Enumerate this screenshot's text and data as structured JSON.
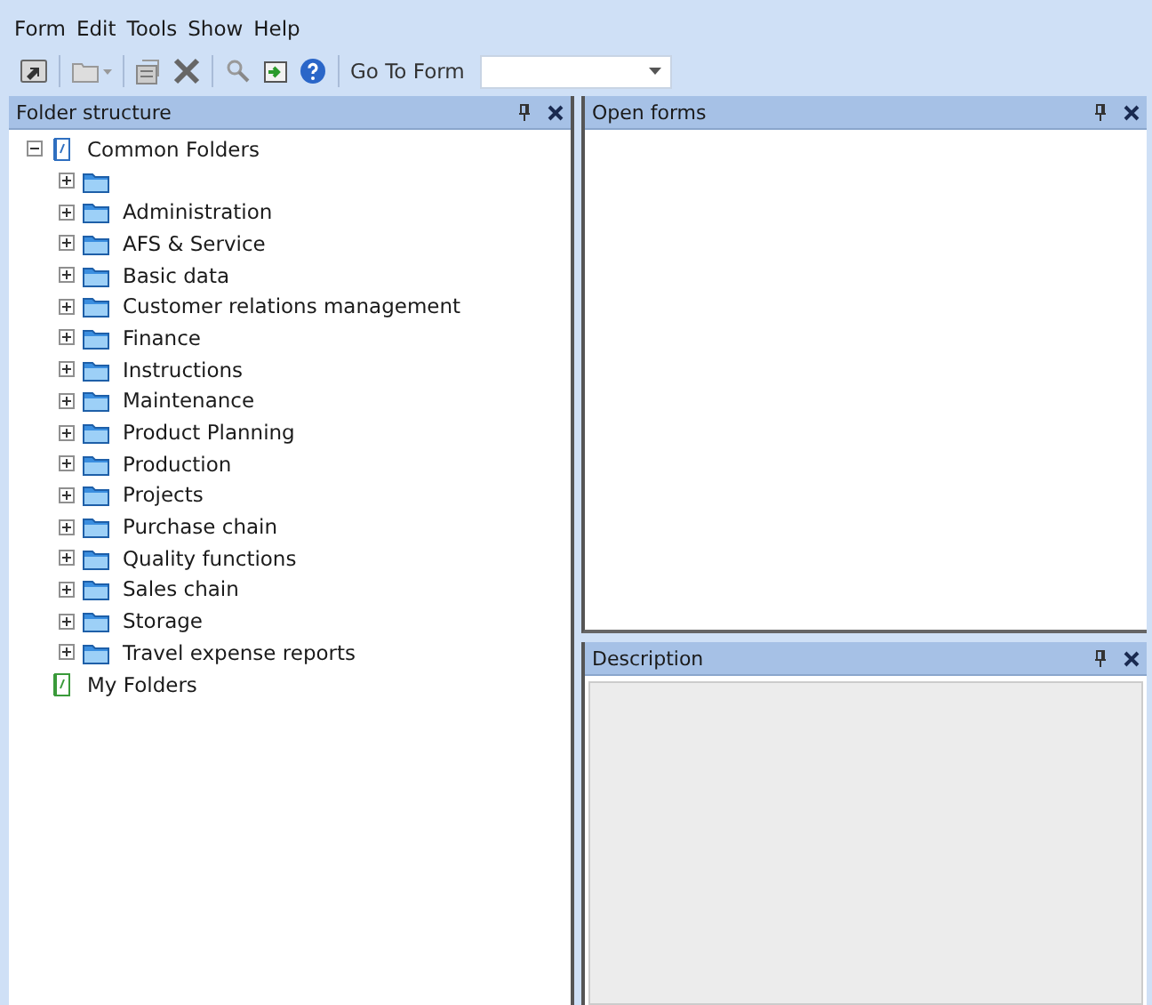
{
  "menu": [
    "Form",
    "Edit",
    "Tools",
    "Show",
    "Help"
  ],
  "toolbar": {
    "items": [
      {
        "kind": "arrow"
      },
      {
        "kind": "sep"
      },
      {
        "kind": "folder-dropdown"
      },
      {
        "kind": "sep"
      },
      {
        "kind": "properties"
      },
      {
        "kind": "delete"
      },
      {
        "kind": "sep"
      },
      {
        "kind": "search"
      },
      {
        "kind": "import"
      },
      {
        "kind": "help"
      },
      {
        "kind": "sep"
      }
    ],
    "goto_label": "Go To Form"
  },
  "folder_panel": {
    "title": "Folder structure",
    "tree": [
      {
        "label": "Common Folders",
        "kind": "shared",
        "expanded": true,
        "children": [
          {
            "expanded": false
          },
          {
            "label": "Administration",
            "expanded": false
          },
          {
            "label": "AFS & Service",
            "expanded": false
          },
          {
            "label": "Basic data",
            "expanded": false
          },
          {
            "label": "Customer relations management",
            "expanded": false
          },
          {
            "label": "Finance",
            "expanded": false
          },
          {
            "label": "Instructions",
            "expanded": false
          },
          {
            "label": "Maintenance",
            "expanded": false
          },
          {
            "label": "Product Planning",
            "expanded": false
          },
          {
            "label": "Production",
            "expanded": false
          },
          {
            "label": "Projects",
            "expanded": false
          },
          {
            "label": "Purchase chain",
            "expanded": false
          },
          {
            "label": "Quality functions",
            "expanded": false
          },
          {
            "label": "Sales chain",
            "expanded": false
          },
          {
            "label": "Storage",
            "expanded": false
          },
          {
            "label": "Travel expense reports",
            "expanded": false
          }
        ]
      },
      {
        "label": "My Folders",
        "kind": "personal"
      }
    ]
  },
  "open_forms_panel": {
    "title": "Open forms"
  },
  "description_panel": {
    "title": "Description"
  }
}
